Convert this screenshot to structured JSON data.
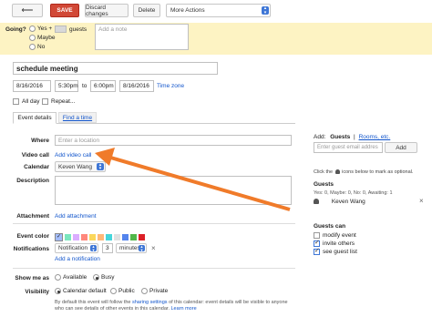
{
  "toolbar": {
    "back_icon": "back-arrow-icon",
    "save": "SAVE",
    "discard": "Discard changes",
    "delete": "Delete",
    "more_actions": "More Actions"
  },
  "going": {
    "label": "Going?",
    "yes": "Yes",
    "plus": "+",
    "guests": "guests",
    "maybe": "Maybe",
    "no": "No",
    "note_placeholder": "Add a note"
  },
  "event": {
    "title": "schedule meeting",
    "start_date": "8/16/2016",
    "start_time": "5:30pm",
    "to": "to",
    "end_time": "6:00pm",
    "end_date": "8/16/2016",
    "timezone": "Time zone",
    "all_day": "All day",
    "repeat": "Repeat..."
  },
  "tabs": {
    "details": "Event details",
    "find_time": "Find a time"
  },
  "form": {
    "where_label": "Where",
    "where_placeholder": "Enter a location",
    "video_label": "Video call",
    "video_link": "Add video call",
    "calendar_label": "Calendar",
    "calendar_value": "Keven Wang",
    "description_label": "Description",
    "attachment_label": "Attachment",
    "attachment_link": "Add attachment",
    "color_label": "Event color",
    "notifications_label": "Notifications",
    "notif_type": "Notification",
    "notif_amount": "3",
    "notif_unit": "minutes",
    "remove": "×",
    "add_notification": "Add a notification",
    "showme_label": "Show me as",
    "available": "Available",
    "busy": "Busy",
    "visibility_label": "Visibility",
    "calendar_default": "Calendar default",
    "public": "Public",
    "private": "Private",
    "footer_1": "By default this event will follow the",
    "footer_link": "sharing settings",
    "footer_2": "of this calendar: event details will be visible to anyone",
    "footer_3": "who can see details of other events in this calendar.",
    "learn_more": "Learn more"
  },
  "sidebar": {
    "add": "Add:",
    "guests": "Guests",
    "sep": "|",
    "rooms": "Rooms, etc.",
    "guest_placeholder": "Enter guest email addres",
    "add_button": "Add",
    "hint": "Click the",
    "hint_2": "icons below to mark as optional.",
    "guests_title": "Guests",
    "guests_summary": "Yes: 0, Maybe: 0, No: 0, Awaiting: 1",
    "guest_name": "Keven Wang",
    "remove": "×",
    "guests_can": "Guests can",
    "modify": "modify event",
    "invite": "invite others",
    "see_list": "see guest list"
  },
  "colors": {
    "accent": "#d14836",
    "link": "#1155cc",
    "going_bg": "#fdf3c3",
    "arrow": "#f07b2a",
    "swatches": [
      "#a4bdfc",
      "#7ae7bf",
      "#dbadff",
      "#ff887c",
      "#fbd75b",
      "#ffb878",
      "#46d6db",
      "#e1e1e1",
      "#5484ed",
      "#51b749",
      "#dc2127"
    ]
  }
}
